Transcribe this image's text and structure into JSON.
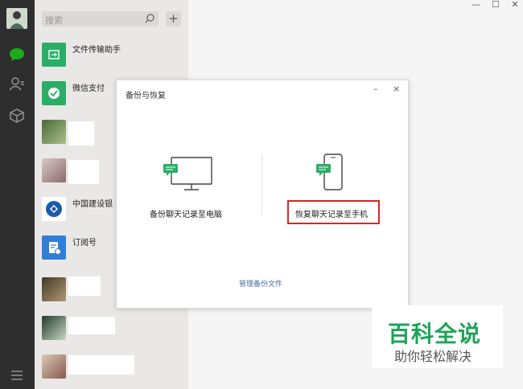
{
  "window": {
    "min_glyph": "—",
    "max_glyph": "☐",
    "close_glyph": "✕"
  },
  "search": {
    "placeholder": "搜索",
    "add_glyph": "+"
  },
  "chats": [
    {
      "name": "文件传输助手",
      "avatar_color": "#2aae67"
    },
    {
      "name": "微信支付",
      "avatar_color": "#2aae67"
    },
    {
      "name": ""
    },
    {
      "name": ""
    },
    {
      "name": "中国建设银",
      "avatar_color": "#1e5aa8"
    },
    {
      "name": "订阅号",
      "avatar_color": "#2f7fd8"
    },
    {
      "name": ""
    },
    {
      "name": ""
    },
    {
      "name": ""
    }
  ],
  "dialog": {
    "title": "备份与恢复",
    "min_glyph": "–",
    "close_glyph": "×",
    "backup_label": "备份聊天记录至电脑",
    "restore_label": "恢复聊天记录至手机",
    "manage_link": "管理备份文件"
  },
  "watermark": {
    "title": "百科全说",
    "subtitle": "助你轻松解决"
  },
  "colors": {
    "sidebar": "#2e2e2e",
    "chatlist": "#e9e8e7",
    "accent_green": "#1aad19",
    "highlight_red": "#d02a2a",
    "link": "#4c6c9e"
  }
}
